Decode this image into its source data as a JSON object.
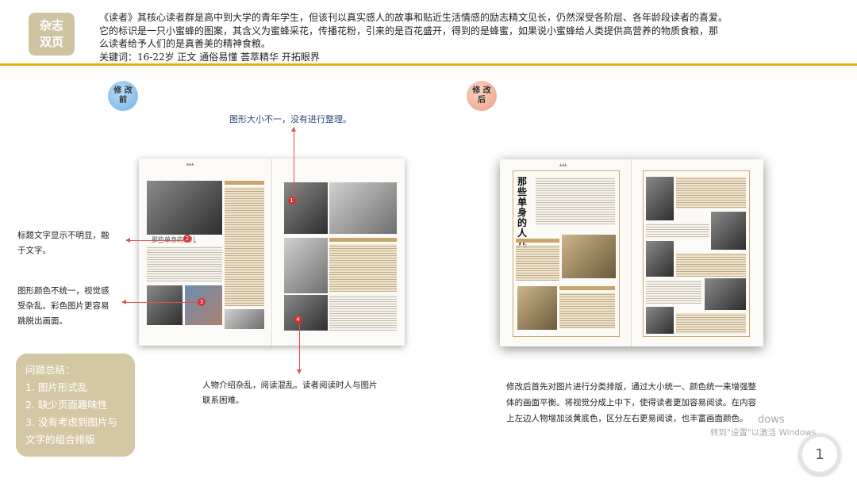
{
  "header": {
    "tag_line1": "杂志",
    "tag_line2": "双页",
    "intro_line1": "《读者》其核心读者群是高中到大学的青年学生，但该刊以真实感人的故事和贴近生活情感的励志精文见长，仍然深受各阶层、各年龄段读者的喜爱。",
    "intro_line2": "它的标识是一只小蜜蜂的图案，其含义为蜜蜂采花，传播花粉，引来的是百花盛开，得到的是蜂蜜，如果说小蜜蜂给人类提供高营养的物质食粮，那",
    "intro_line3": "么读者给予人们的是真善美的精神食粮。",
    "keywords": "关键词：16-22岁    正文  通俗易懂    荟萃精华  开拓眼界",
    "rule_color": "#e8b20e"
  },
  "badges": {
    "before_line1": "修 改",
    "before_line2": "前",
    "after_line1": "修 改",
    "after_line2": "后"
  },
  "annotations": {
    "top": "图形大小不一，没有进行整理。",
    "title_line1": "标题文字显示不明显，融",
    "title_line2": "于文字。",
    "color_line1": "图形颜色不统一，视觉感",
    "color_line2": "受杂乱。彩色图片更容易",
    "color_line3": "跳脱出画面。",
    "bottom_line1": "人物介绍杂乱，阅读混乱。读者阅读时人与图片",
    "bottom_line2": "联系困难。",
    "after_line1": "修改后首先对图片进行分类排版，通过大小统一、颜色统一来增强整",
    "after_line2": "体的画面平衡。将视觉分成上中下，使得读者更加容易阅读。在内容",
    "after_line3": "上左边人物增加淡黄底色，区分左右更易阅读，也丰富画面颜色。"
  },
  "summary": {
    "title": "问题总结：",
    "items": [
      "1. 图片形式乱",
      "2. 缺少页面趣味性",
      "3. 没有考虑到图片与",
      "文字的组合排版"
    ]
  },
  "spreads": {
    "before_title": "那些单身的人儿",
    "after_title": "那些单身的人儿",
    "markers": [
      "1",
      "2",
      "3",
      "4"
    ]
  },
  "watermark": {
    "line1": "dows",
    "line2": "转到\"设置\"以激活 Windows。"
  },
  "page_number": "1",
  "colors": {
    "tag_bg": "#cfc3a1",
    "summary_bg": "#d4c8a4",
    "arrow": "#e05050",
    "before_badge": "#6fb0e6",
    "after_badge": "#ee9e86"
  }
}
